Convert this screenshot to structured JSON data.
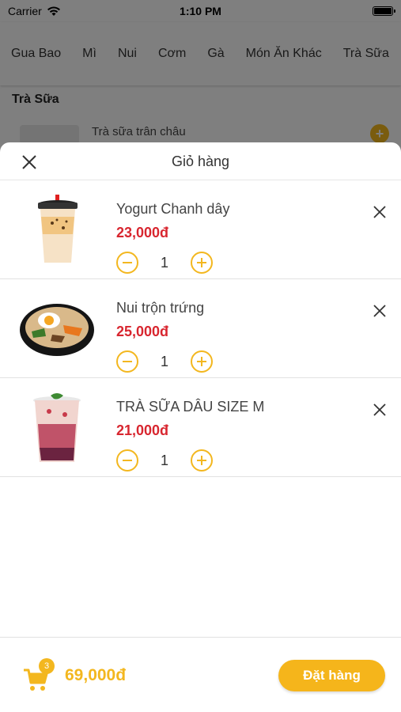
{
  "status_bar": {
    "carrier": "Carrier",
    "time": "1:10 PM"
  },
  "categories": [
    "Gua Bao",
    "Mì",
    "Nui",
    "Cơm",
    "Gà",
    "Món Ăn Khác",
    "Trà Sữa"
  ],
  "background": {
    "section_title": "Trà Sữa",
    "row_name": "Trà sữa trân châu",
    "add_symbol": "+"
  },
  "cart": {
    "title": "Giỏ hàng",
    "items": [
      {
        "name": "Yogurt Chanh dây",
        "price": "23,000đ",
        "qty": "1",
        "image_icon": "yogurt-cup-image"
      },
      {
        "name": "Nui trộn trứng",
        "price": "25,000đ",
        "qty": "1",
        "image_icon": "noodle-bowl-image"
      },
      {
        "name": "TRÀ SỮA DÂU SIZE M",
        "price": "21,000đ",
        "qty": "1",
        "image_icon": "strawberry-milk-tea-image"
      }
    ],
    "badge_count": "3",
    "total": "69,000đ",
    "order_button": "Đặt hàng"
  },
  "colors": {
    "accent": "#F3B71F",
    "price": "#D8262F"
  }
}
